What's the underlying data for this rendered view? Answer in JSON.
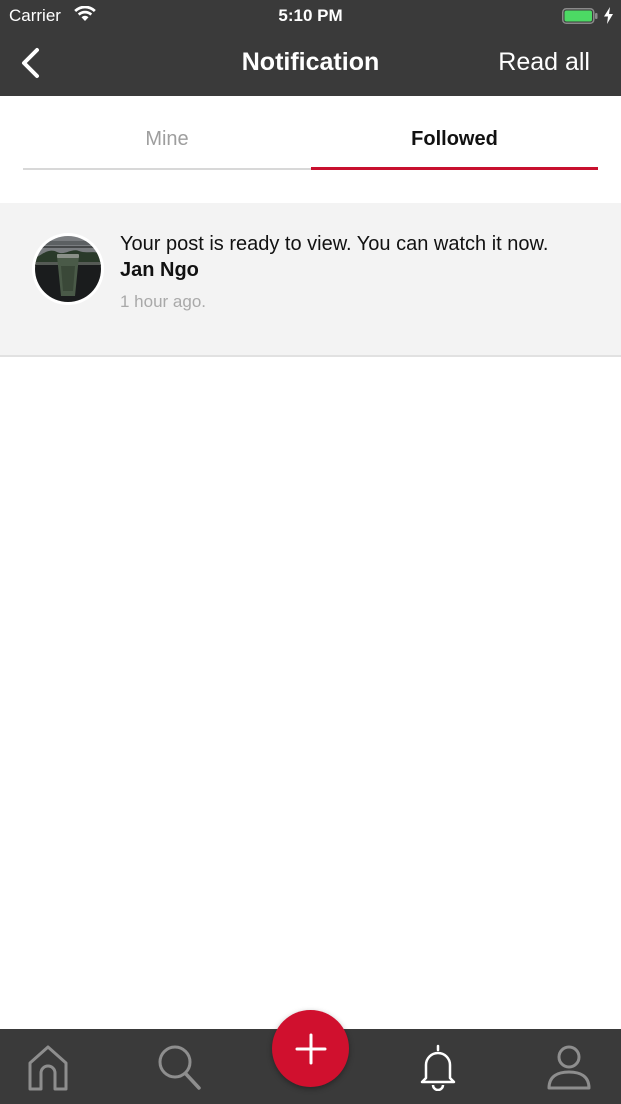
{
  "status_bar": {
    "carrier": "Carrier",
    "time": "5:10 PM",
    "wifi_icon": "wifi-icon",
    "battery_icon": "battery-icon"
  },
  "nav": {
    "title": "Notification",
    "back_icon": "chevron-left-icon",
    "read_all_label": "Read all"
  },
  "tabs": [
    {
      "label": "Mine",
      "active": false
    },
    {
      "label": "Followed",
      "active": true
    }
  ],
  "notifications": [
    {
      "message": "Your post is ready to view. You can watch it now.",
      "author": "Jan Ngo",
      "time": "1 hour ago."
    }
  ],
  "tab_bar": {
    "items": [
      "home-icon",
      "search-icon",
      "add-icon",
      "bell-icon",
      "user-icon"
    ],
    "active": "bell-icon"
  },
  "colors": {
    "bar_background": "#3a3a3a",
    "accent": "#c8102e",
    "battery": "#4cd964",
    "item_background": "#f3f3f3"
  }
}
